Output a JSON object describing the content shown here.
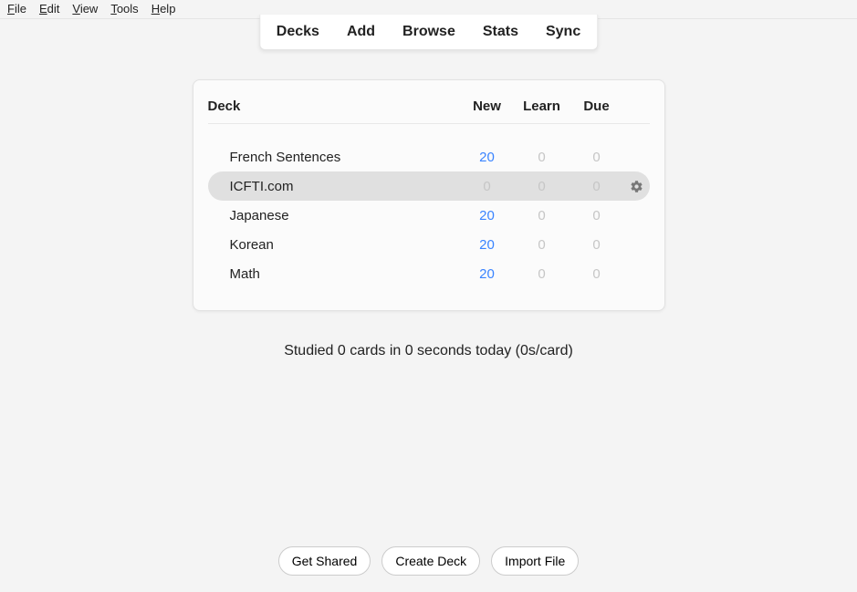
{
  "menubar": [
    {
      "accel": "F",
      "rest": "ile"
    },
    {
      "accel": "E",
      "rest": "dit"
    },
    {
      "accel": "V",
      "rest": "iew"
    },
    {
      "accel": "T",
      "rest": "ools"
    },
    {
      "accel": "H",
      "rest": "elp"
    }
  ],
  "nav": [
    "Decks",
    "Add",
    "Browse",
    "Stats",
    "Sync"
  ],
  "deck_table": {
    "headers": {
      "name": "Deck",
      "new": "New",
      "learn": "Learn",
      "due": "Due"
    },
    "rows": [
      {
        "name": "French Sentences",
        "new": "20",
        "learn": "0",
        "due": "0",
        "hover": false
      },
      {
        "name": "ICFTI.com",
        "new": "0",
        "learn": "0",
        "due": "0",
        "hover": true
      },
      {
        "name": "Japanese",
        "new": "20",
        "learn": "0",
        "due": "0",
        "hover": false
      },
      {
        "name": "Korean",
        "new": "20",
        "learn": "0",
        "due": "0",
        "hover": false
      },
      {
        "name": "Math",
        "new": "20",
        "learn": "0",
        "due": "0",
        "hover": false
      }
    ]
  },
  "status": "Studied 0 cards in 0 seconds today (0s/card)",
  "bottom_buttons": [
    "Get Shared",
    "Create Deck",
    "Import File"
  ]
}
